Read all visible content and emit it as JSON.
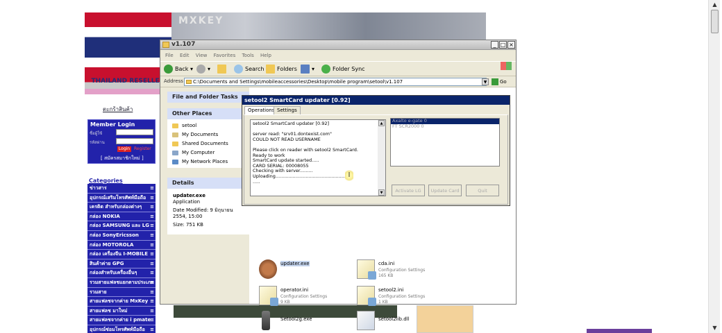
{
  "site": {
    "logo_brand": "MXKEY",
    "reseller": "THAILAND RESELLER",
    "cart_link": "ตะกร้าสินค้า",
    "member": {
      "title": "Member Login",
      "login_button": "Login",
      "register_link": "Register",
      "join_link": "[ สมัครสมาชิกใหม่ ]"
    },
    "categories_title": "Categories",
    "categories": [
      "ข่าวสาร",
      "อุปกรณ์เสริมโทรศัพท์มือถือ",
      "เครดิต สำหรับกล่องต่างๆ",
      "กล่อง NOKIA",
      "กล่อง SAMSUNG และ LG",
      "กล่อง SonyEricsson",
      "กล่อง MOTOROLA",
      "กล่อง เครื่องจีน I-MOBILE",
      "สินค้าค่าย GPG",
      "กล่องสำหรับเครื่องอื่นๆ",
      "รวมสายแฟลชแยกตามประเภท",
      "รวมสาย",
      "สายแฟลชจากค่าย MxKey",
      "สายแฟลช มาใหม่",
      "สายแฟลชจากค่าย i pmate",
      "อุปกรณ์ซ่อมโทรศัพท์มือถือ"
    ]
  },
  "explorer": {
    "title": "v1.107",
    "menu": [
      "File",
      "Edit",
      "View",
      "Favorites",
      "Tools",
      "Help"
    ],
    "toolbar": {
      "back": "Back",
      "search": "Search",
      "folders": "Folders",
      "folder_sync": "Folder Sync"
    },
    "address_label": "Address",
    "address_value": "C:\\Documents and Settings\\mobileaccessories\\Desktop\\mobile program\\setool\\v1.107",
    "go_label": "Go",
    "file_tasks": "File and Folder Tasks",
    "other_places_title": "Other Places",
    "other_places": [
      "setool",
      "My Documents",
      "Shared Documents",
      "My Computer",
      "My Network Places"
    ],
    "details_title": "Details",
    "details": {
      "name": "updater.exe",
      "type": "Application",
      "modified": "Date Modified: 9 มิถุนายน 2554, 15:00",
      "size": "Size: 751 KB"
    },
    "files": [
      {
        "name": "updater.exe",
        "type": "",
        "size": ""
      },
      {
        "name": "cda.ini",
        "type": "Configuration Settings",
        "size": "165 KB"
      },
      {
        "name": "operator.ini",
        "type": "Configuration Settings",
        "size": "9 KB"
      },
      {
        "name": "setool2.ini",
        "type": "Configuration Settings",
        "size": "1 KB"
      },
      {
        "name": "Setool2g.exe",
        "type": "",
        "size": ""
      },
      {
        "name": "setool2lib.dll",
        "type": "",
        "size": ""
      }
    ]
  },
  "dialog": {
    "title": "setool2 SmartCard updater [0.92]",
    "tabs": [
      "Operations",
      "Settings"
    ],
    "log": "setool2 SmartCard updater [0.92]\n\nserver read: \"srv01.dontexist.com\"\nCOULD NOT READ USERNAME\n\nPlease click on reader with setool2 SmartCard.\nReady to work\nSmartCard update started.....\nCARD SERIAL: 00008055\nChecking with server.........\nUploading.................................................\n.....",
    "readers": [
      "Axalto e-gate 0",
      "FT SCR2000 0"
    ],
    "buttons": [
      "Activate LG",
      "Update Card",
      "Quit"
    ]
  }
}
